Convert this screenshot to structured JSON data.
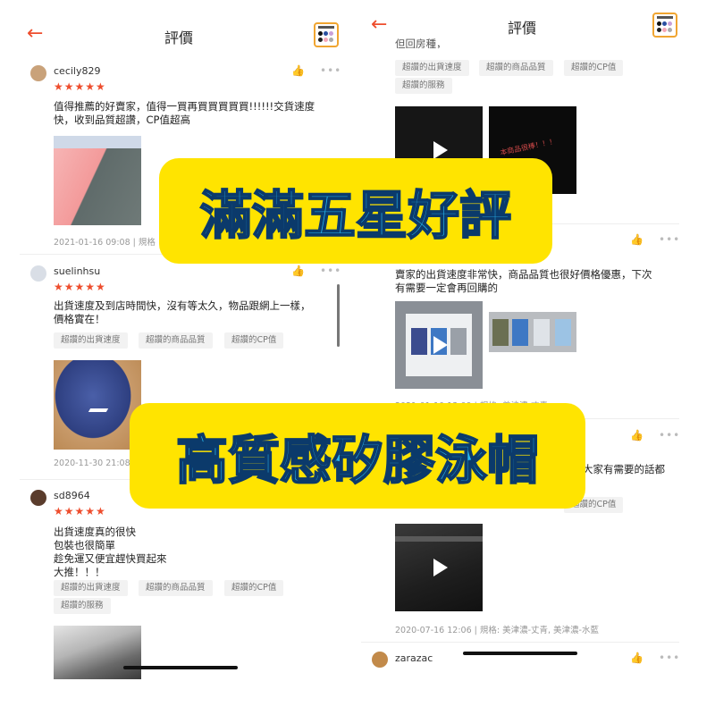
{
  "left": {
    "header": {
      "title": "評價"
    },
    "reviews": [
      {
        "username": "cecily829",
        "stars": "★★★★★",
        "text": "值得推薦的好賣家，值得一買再買買買買買!!!!!!交貨速度\n快，收到品質超讚，CP值超高",
        "meta": "2021-01-16 09:08 | 規格"
      },
      {
        "username": "suelinhsu",
        "stars": "★★★★★",
        "text": "出貨速度及到店時間快，沒有等太久，物品跟網上一樣，\n價格實在！",
        "tags": [
          "超讚的出貨速度",
          "超讚的商品品質",
          "超讚的CP值"
        ],
        "meta": "2020-11-30 21:08"
      },
      {
        "username": "sd8964",
        "stars": "★★★★★",
        "text": "出貨速度真的很快\n包裝也很簡單\n趁免運又便宜趕快買起來\n大推！！！",
        "tags": [
          "超讚的出貨速度",
          "超讚的商品品質",
          "超讚的CP值",
          "超讚的服務"
        ]
      }
    ]
  },
  "right": {
    "header": {
      "title": "評價"
    },
    "top_partial_text": "但回房種，",
    "top_tags": [
      "超讚的出貨速度",
      "超讚的商品品質",
      "超讚的CP值",
      "超讚的服務"
    ],
    "handwriting": "本商品很棒！！！",
    "review2_text": "賣家的出貨速度非常快，商品品質也很好價格優惠，下次\n有需要一定會再回購的",
    "review2_meta": "2021-01-10 13:09 | 規格: 美津濃-丈青",
    "review3_partial_text": "大家有需要的話都",
    "review3_tag": "超讚的CP值",
    "review3_meta": "2020-07-16 12:06 | 規格: 美津濃-丈青, 美津濃-水藍",
    "next_user": "zarazac"
  },
  "icons": {
    "back": "back-arrow-icon",
    "like": "thumbs-up-icon",
    "more": "more-icon",
    "play": "play-icon",
    "logo": "shop-logo-icon"
  },
  "banners": {
    "top": "滿滿五星好評",
    "bottom": "高質感矽膠泳帽"
  },
  "colors": {
    "accent": "#ee4d2d",
    "banner_bg": "#ffe400",
    "banner_text": "#29b8f0",
    "banner_stroke": "#0b3a6b"
  }
}
